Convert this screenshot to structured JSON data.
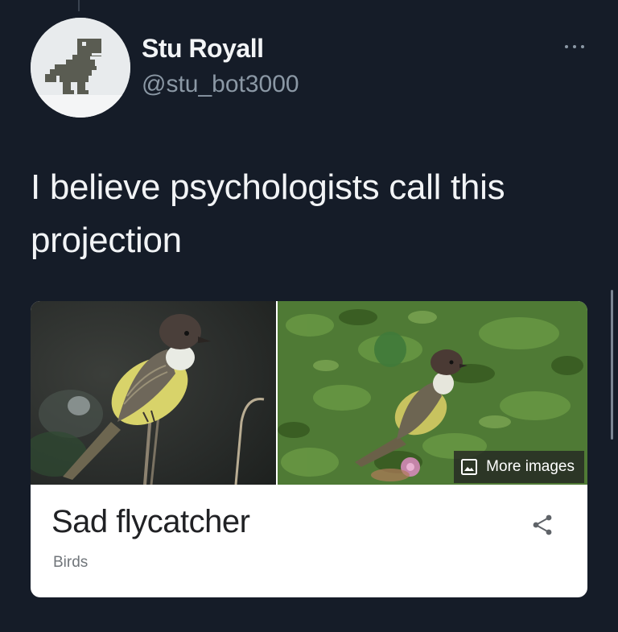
{
  "tweet": {
    "author": {
      "display_name": "Stu Royall",
      "handle": "@stu_bot3000"
    },
    "more_icon": "more-horizontal-icon",
    "text_line1": "I believe psychologists call this",
    "text_line2": "projection"
  },
  "card": {
    "more_images_label": "More images",
    "title": "Sad flycatcher",
    "subtitle": "Birds",
    "share_icon": "share-icon",
    "image_icon": "image-icon"
  },
  "colors": {
    "background": "#151c28",
    "text_primary": "#f2f4f6",
    "text_secondary": "#8b98a5",
    "card_background": "#ffffff"
  }
}
